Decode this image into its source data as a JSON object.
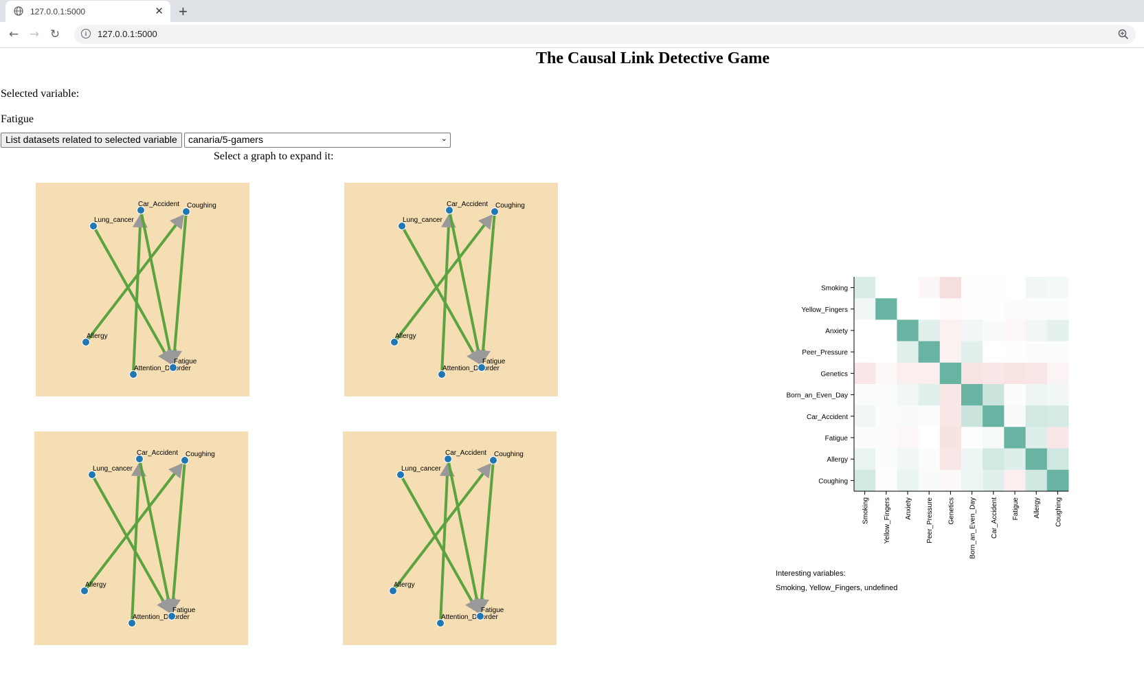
{
  "browser": {
    "tab_title": "127.0.0.1:5000",
    "url": "127.0.0.1:5000",
    "new_tab_glyph": "+",
    "close_glyph": "✕",
    "icons": [
      "globe-icon",
      "close-icon",
      "plus-icon",
      "back-arrow-icon",
      "forward-arrow-icon",
      "reload-icon",
      "info-icon",
      "zoom-icon"
    ]
  },
  "page": {
    "title": "The Causal Link Detective Game",
    "selected_label": "Selected variable:",
    "selected_value": "Fatigue",
    "list_button": "List datasets related to selected variable",
    "dataset_selected": "canaria/5-gamers",
    "graph_prompt": "Select a graph to expand it:"
  },
  "graphs": {
    "count": 4,
    "background": "#f5deb3",
    "node_color": "#1f77b4",
    "edge_color": "#5ba33f",
    "arrow_color": "#999999",
    "nodes": [
      "Lung_cancer",
      "Car_Accident",
      "Coughing",
      "Allergy",
      "Attention_Disorder",
      "Fatigue"
    ],
    "edges": [
      {
        "from": "Lung_cancer",
        "to": "Fatigue"
      },
      {
        "from": "Attention_Disorder",
        "to": "Car_Accident"
      },
      {
        "from": "Car_Accident",
        "to": "Fatigue"
      },
      {
        "from": "Allergy",
        "to": "Coughing"
      },
      {
        "from": "Coughing",
        "to": "Fatigue"
      }
    ]
  },
  "chart_data": {
    "type": "heatmap",
    "rows": [
      "Smoking",
      "Yellow_Fingers",
      "Anxiety",
      "Peer_Pressure",
      "Genetics",
      "Born_an_Even_Day",
      "Car_Accident",
      "Fatigue",
      "Allergy",
      "Coughing"
    ],
    "columns": [
      "Smoking",
      "Yellow_Fingers",
      "Anxiety",
      "Peer_Pressure",
      "Genetics",
      "Born_an_Even_Day",
      "Car_Accident",
      "Fatigue",
      "Allergy",
      "Coughing"
    ],
    "values": [
      [
        0.25,
        0.0,
        0.0,
        -0.1,
        -0.35,
        -0.02,
        -0.02,
        0.0,
        0.1,
        0.08
      ],
      [
        0.1,
        1.0,
        0.0,
        0.0,
        -0.05,
        -0.02,
        -0.02,
        -0.04,
        0.03,
        0.03
      ],
      [
        0.0,
        0.0,
        1.0,
        0.2,
        -0.15,
        0.1,
        0.05,
        -0.08,
        0.1,
        0.18
      ],
      [
        0.0,
        0.0,
        0.2,
        1.0,
        -0.15,
        0.2,
        0.0,
        -0.02,
        0.03,
        0.03
      ],
      [
        -0.25,
        -0.08,
        -0.18,
        -0.18,
        1.0,
        -0.28,
        -0.25,
        -0.28,
        -0.25,
        -0.12
      ],
      [
        0.03,
        0.03,
        0.1,
        0.2,
        -0.25,
        1.0,
        0.35,
        0.03,
        0.12,
        0.1
      ],
      [
        0.1,
        0.03,
        0.05,
        0.03,
        -0.25,
        0.35,
        1.0,
        0.05,
        0.3,
        0.28
      ],
      [
        0.03,
        -0.04,
        -0.08,
        0.0,
        -0.3,
        0.02,
        0.06,
        1.0,
        0.22,
        -0.25
      ],
      [
        0.15,
        0.03,
        0.1,
        0.04,
        -0.25,
        0.12,
        0.3,
        0.22,
        1.0,
        0.32
      ],
      [
        0.3,
        0.02,
        0.15,
        0.05,
        -0.06,
        0.12,
        0.2,
        -0.18,
        0.32,
        1.0
      ]
    ],
    "value_range": [
      -1,
      1
    ],
    "positive_color": "#69b3a2",
    "negative_color": "#e8a0a0",
    "neutral_color": "#ffffff"
  },
  "interesting": {
    "label": "Interesting variables:",
    "value": "Smoking, Yellow_Fingers, undefined"
  }
}
